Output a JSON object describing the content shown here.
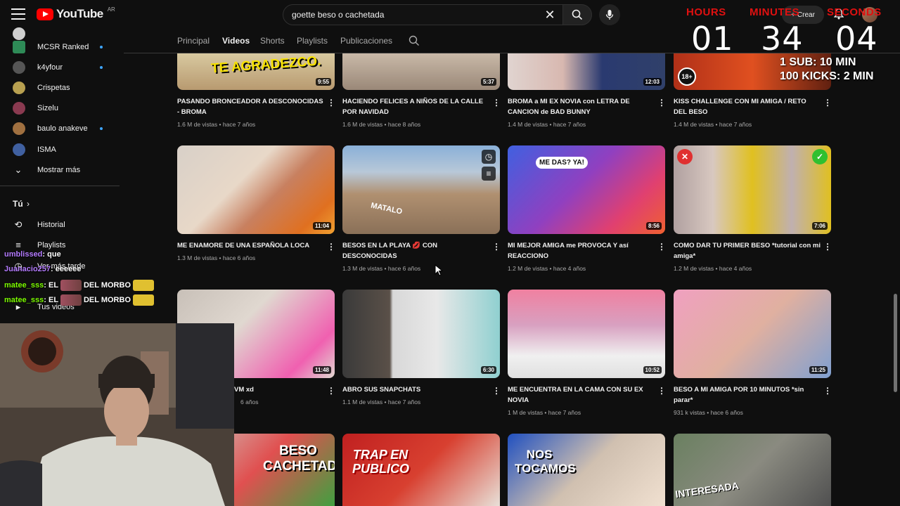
{
  "header": {
    "logo_text": "YouTube",
    "logo_country": "AR",
    "search_value": "goette beso o cachetada",
    "create_label": "Crear"
  },
  "sidebar": {
    "subscriptions": [
      {
        "label": "MCSR Ranked",
        "new": true,
        "color": "#2e8b57"
      },
      {
        "label": "k4yfour",
        "new": true,
        "color": "#555555"
      },
      {
        "label": "Crispetas",
        "new": false,
        "color": "#b8a050"
      },
      {
        "label": "Sizelu",
        "new": false,
        "color": "#8a3a50"
      },
      {
        "label": "baulo anakeve",
        "new": true,
        "color": "#a07040"
      },
      {
        "label": "ISMA",
        "new": false,
        "color": "#4060a0"
      }
    ],
    "show_more": "Mostrar más",
    "you_section": "Tú",
    "history": "Historial",
    "playlists": "Playlists",
    "watch_later": "Ver más tarde",
    "your_videos": "Tus videos"
  },
  "tabs": {
    "items": [
      "Principal",
      "Videos",
      "Shorts",
      "Playlists",
      "Publicaciones"
    ],
    "active": "Videos"
  },
  "videos_row0": [
    {
      "title": "PASANDO BRONCEADOR A DESCONOCIDAS - BROMA",
      "meta": "1.6 M de vistas • hace 7 años",
      "duration": "9:55",
      "overlay": "TE AGRADEZCO."
    },
    {
      "title": "HACIENDO FELICES A NIÑOS DE LA CALLE POR NAVIDAD",
      "meta": "1.6 M de vistas • hace 8 años",
      "duration": "5:37"
    },
    {
      "title": "BROMA a MI EX NOVIA con LETRA DE CANCION de BAD BUNNY",
      "meta": "1.4 M de vistas • hace 7 años",
      "duration": "12:03"
    },
    {
      "title": "KISS CHALLENGE CON MI AMIGA / RETO DEL BESO",
      "meta": "1.4 M de vistas • hace 7 años",
      "duration": "",
      "badge": "18+"
    }
  ],
  "videos_row1": [
    {
      "title": "ME ENAMORE DE UNA ESPAÑOLA LOCA",
      "meta": "1.3 M de vistas • hace 6 años",
      "duration": "11:04"
    },
    {
      "title": "BESOS EN LA PLAYA 💋 CON DESCONOCIDAS",
      "meta": "1.3 M de vistas • hace 6 años",
      "duration": "",
      "overlay": "MATALO"
    },
    {
      "title": "MI MEJOR AMIGA me PROVOCA Y así REACCIONO",
      "meta": "1.2 M de vistas • hace 4 años",
      "duration": "8:56",
      "overlay": "ME DAS? YA!"
    },
    {
      "title": "COMO DAR TU PRIMER BESO *tutorial con mi amiga*",
      "meta": "1.2 M de vistas • hace 4 años",
      "duration": "7:06"
    }
  ],
  "videos_row2": [
    {
      "title": "VM xd",
      "meta": "6 años",
      "duration": "11:48"
    },
    {
      "title": "ABRO SUS SNAPCHATS",
      "meta": "1.1 M de vistas • hace 7 años",
      "duration": "6:30"
    },
    {
      "title": "ME ENCUENTRA EN LA CAMA CON SU EX NOVIA",
      "meta": "1 M de vistas • hace 7 años",
      "duration": "10:52"
    },
    {
      "title": "BESO A MI AMIGA POR 10 MINUTOS *sin parar*",
      "meta": "931 k vistas • hace 6 años",
      "duration": "11:25"
    }
  ],
  "videos_row3_overlays": [
    "BESO CACHETADA?",
    "TRAP EN PUBLICO",
    "NOS TOCAMOS",
    "INTERESADA"
  ],
  "timer": {
    "hours_label": "HOURS",
    "minutes_label": "MINUTES",
    "seconds_label": "SECONDS",
    "hours": "01",
    "minutes": "34",
    "seconds": "04",
    "note1": "1 SUB: 10 MIN",
    "note2": "100 KICKS: 2 MIN"
  },
  "chat": [
    {
      "user": "umblissed",
      "msg": ": que"
    },
    {
      "user": "Juanacio257",
      "msg": ": eeeeee"
    },
    {
      "user": "matee_sss",
      "msg": ": EL",
      "tail": "DEL MORBO"
    },
    {
      "user": "matee_sss",
      "msg": ": EL",
      "tail": "DEL MORBO"
    }
  ],
  "colors": {
    "background": "#0f0f0f",
    "brand_red": "#ff0000",
    "timer_red": "#e01010",
    "link_blue": "#3ea6ff"
  }
}
